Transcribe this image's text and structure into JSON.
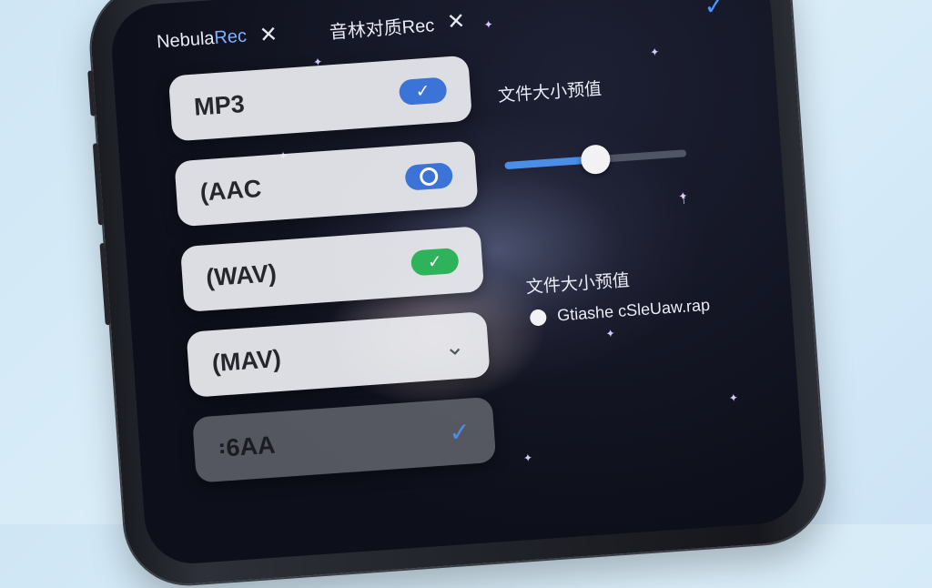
{
  "tabs": [
    {
      "label_prefix": "Nebula",
      "label_accent": "Rec",
      "close": "✕"
    },
    {
      "label": "音林对质Rec",
      "close": "✕"
    }
  ],
  "confirm_icon": "✓",
  "formats": [
    {
      "label": "MP3",
      "control": "toggle-check",
      "checked": true,
      "color": "#3b74d6"
    },
    {
      "label": "(AAC",
      "control": "toggle-ring",
      "checked": false,
      "color": "#3b74d6"
    },
    {
      "label": "(WAV)",
      "control": "toggle-check",
      "checked": true,
      "color": "#2fb35a"
    },
    {
      "label": "(MAV)",
      "control": "chevron-down"
    },
    {
      "label": "꞉6AA",
      "control": "check",
      "dimmed": true
    }
  ],
  "right": {
    "size_label_1": "文件大小预值",
    "slider_value": 0.5,
    "small_glyph": "↑",
    "size_label_2": "文件大小预值",
    "radio_text": "Gtiashe cSleUaw.rap"
  },
  "colors": {
    "accent": "#4b8ee8",
    "green": "#2fb35a"
  }
}
